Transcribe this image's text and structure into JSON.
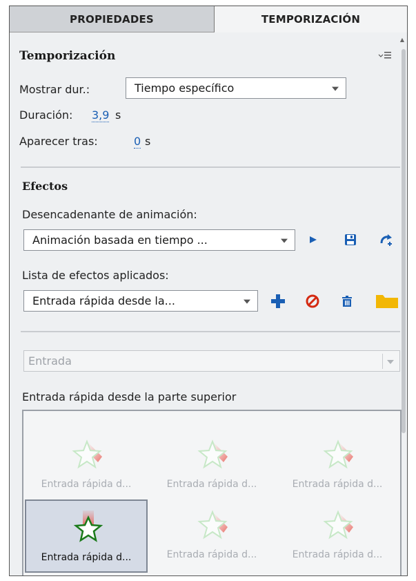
{
  "tabs": [
    {
      "label": "PROPIEDADES"
    },
    {
      "label": "TEMPORIZACIÓN"
    }
  ],
  "panel": {
    "title": "Temporización",
    "menu_icon": "panel-menu-icon"
  },
  "timing": {
    "show_duration_label": "Mostrar dur.:",
    "show_duration_value": "Tiempo específico",
    "duration_label": "Duración:",
    "duration_value": "3,9",
    "duration_unit": "s",
    "appear_after_label": "Aparecer tras:",
    "appear_after_value": "0",
    "appear_after_unit": "s"
  },
  "effects": {
    "section_title": "Efectos",
    "trigger_label": "Desencadenante de animación:",
    "trigger_value": "Animación basada en tiempo ...",
    "applied_label": "Lista de efectos aplicados:",
    "applied_value": "Entrada rápida desde la...",
    "category_value": "Entrada",
    "effect_name": "Entrada rápida desde la parte superior",
    "icons": [
      "play-icon",
      "save-icon",
      "redo-icon",
      "add-icon",
      "no-icon",
      "trash-icon",
      "folder-icon"
    ],
    "colors": {
      "accent": "#1a5fb4",
      "danger": "#d42a12",
      "folder": "#f2b705"
    },
    "grid": [
      {
        "caption": "Entrada rápida d...",
        "selected": false
      },
      {
        "caption": "Entrada rápida d...",
        "selected": false
      },
      {
        "caption": "Entrada rápida d...",
        "selected": false
      },
      {
        "caption": "Entrada rápida d...",
        "selected": true
      },
      {
        "caption": "Entrada rápida d...",
        "selected": false
      },
      {
        "caption": "Entrada rápida d...",
        "selected": false
      }
    ]
  }
}
